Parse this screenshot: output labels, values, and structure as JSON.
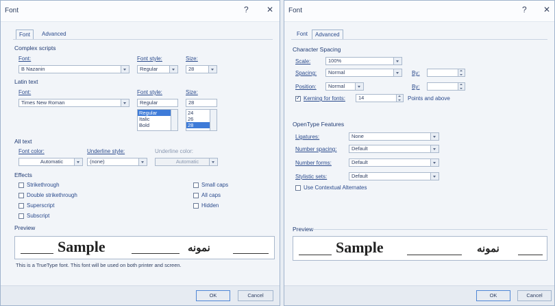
{
  "left_dialog": {
    "title": "Font",
    "help": "?",
    "close": "✕",
    "tabs": [
      "Font",
      "Advanced"
    ],
    "complex": {
      "heading": "Complex scripts",
      "font_label": "Font:",
      "font_value": "B Nazanin",
      "style_label": "Font style:",
      "style_value": "Regular",
      "size_label": "Size:",
      "size_value": "28"
    },
    "latin": {
      "heading": "Latin text",
      "font_label": "Font:",
      "font_value": "Times New Roman",
      "style_label": "Font style:",
      "style_value": "Regular",
      "style_options": [
        "Regular",
        "Italic",
        "Bold"
      ],
      "size_label": "Size:",
      "size_value": "28",
      "size_options": [
        "24",
        "26",
        "28"
      ]
    },
    "all_text": {
      "heading": "All text",
      "color_label": "Font color:",
      "color_value": "Automatic",
      "underline_label": "Underline style:",
      "underline_value": "(none)",
      "underline_color_label": "Underline color:",
      "underline_color_value": "Automatic"
    },
    "effects": {
      "heading": "Effects",
      "left": [
        "Strikethrough",
        "Double strikethrough",
        "Superscript",
        "Subscript"
      ],
      "right": [
        "Small caps",
        "All caps",
        "Hidden"
      ]
    },
    "preview": {
      "heading": "Preview",
      "sample_en": "Sample",
      "sample_ar": "نمونه",
      "note": "This is a TrueType font. This font will be used on both printer and screen."
    },
    "buttons": {
      "ok": "OK",
      "cancel": "Cancel"
    }
  },
  "right_dialog": {
    "title": "Font",
    "help": "?",
    "close": "✕",
    "tabs": [
      "Font",
      "Advanced"
    ],
    "spacing": {
      "heading": "Character Spacing",
      "scale_label": "Scale:",
      "scale_value": "100%",
      "spacing_label": "Spacing:",
      "spacing_value": "Normal",
      "by_label": "By:",
      "position_label": "Position:",
      "position_value": "Normal",
      "by2_label": "By:",
      "kerning_label": "Kerning for fonts:",
      "kerning_value": "14",
      "kerning_suffix": "Points and above"
    },
    "opentype": {
      "heading": "OpenType Features",
      "ligatures_label": "Ligatures:",
      "ligatures_value": "None",
      "num_spacing_label": "Number spacing:",
      "num_spacing_value": "Default",
      "num_forms_label": "Number forms:",
      "num_forms_value": "Default",
      "stylistic_label": "Stylistic sets:",
      "stylistic_value": "Default",
      "contextual_label": "Use Contextual Alternates"
    },
    "preview": {
      "heading": "Preview",
      "sample_en": "Sample",
      "sample_ar": "نمونه"
    },
    "buttons": {
      "ok": "OK",
      "cancel": "Cancel"
    }
  },
  "colors": {
    "selection": "#3e7bd8",
    "label": "#2a4a8c",
    "border": "#9fb3cc"
  }
}
